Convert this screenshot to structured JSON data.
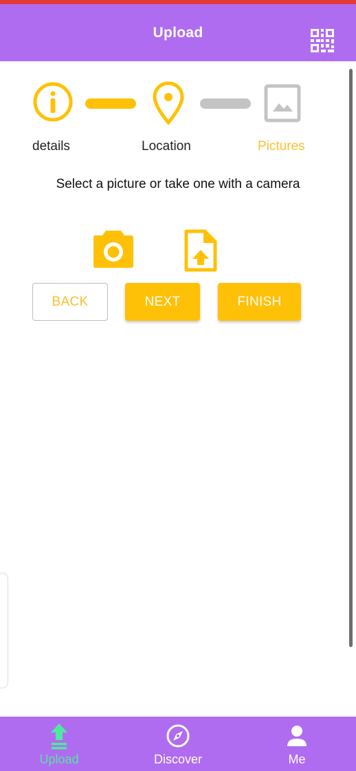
{
  "header": {
    "title": "Upload",
    "qr_icon": "qr-code-icon"
  },
  "stepper": {
    "steps": [
      {
        "label": "details",
        "icon": "info-icon",
        "state": "completed"
      },
      {
        "label": "Location",
        "icon": "location-pin-icon",
        "state": "completed"
      },
      {
        "label": "Pictures",
        "icon": "image-icon",
        "state": "active"
      }
    ],
    "connectors": [
      "completed",
      "pending"
    ]
  },
  "instruction": "Select a picture or take one with a camera",
  "actions": {
    "camera_icon": "camera-icon",
    "file_upload_icon": "file-upload-icon"
  },
  "buttons": {
    "back": "BACK",
    "next": "NEXT",
    "finish": "FINISH"
  },
  "bottom_nav": {
    "items": [
      {
        "label": "Upload",
        "icon": "upload-icon",
        "active": true
      },
      {
        "label": "Discover",
        "icon": "compass-icon",
        "active": false
      },
      {
        "label": "Me",
        "icon": "person-icon",
        "active": false
      }
    ]
  },
  "colors": {
    "header_bg": "#b06cf0",
    "accent": "#ffc107",
    "active_label": "#fbc02d",
    "nav_active": "#4ee8a0",
    "inactive_gray": "#c4c4c4"
  }
}
